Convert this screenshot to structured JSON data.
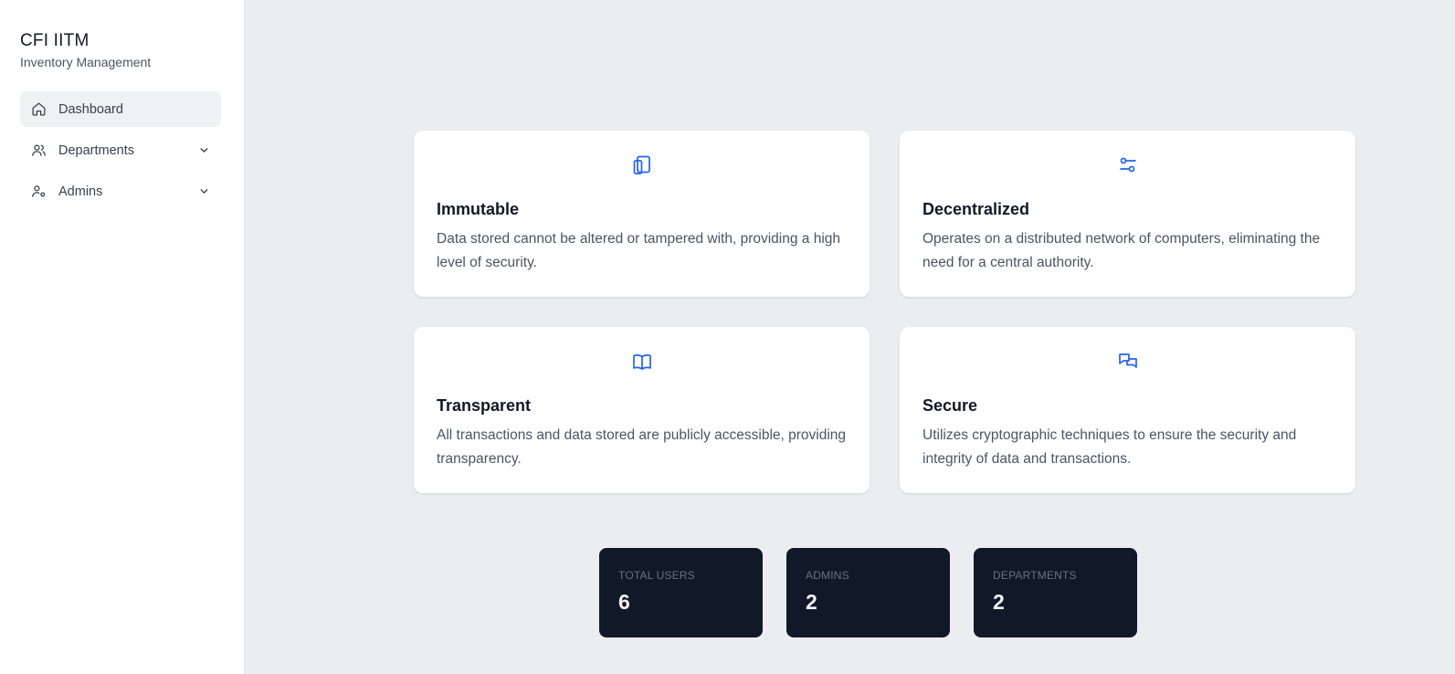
{
  "sidebar": {
    "title": "CFI IITM",
    "subtitle": "Inventory Management",
    "items": [
      {
        "label": "Dashboard",
        "icon": "home-icon",
        "active": true
      },
      {
        "label": "Departments",
        "icon": "users-icon",
        "expandable": true
      },
      {
        "label": "Admins",
        "icon": "user-cog-icon",
        "expandable": true
      }
    ]
  },
  "features": [
    {
      "title": "Immutable",
      "description": "Data stored cannot be altered or tampered with, providing a high level of security.",
      "icon": "tablet-icon"
    },
    {
      "title": "Decentralized",
      "description": "Operates on a distributed network of computers, eliminating the need for a central authority.",
      "icon": "sliders-icon"
    },
    {
      "title": "Transparent",
      "description": "All transactions and data stored are publicly accessible, providing transparency.",
      "icon": "book-open-icon"
    },
    {
      "title": "Secure",
      "description": "Utilizes cryptographic techniques to ensure the security and integrity of data and transactions.",
      "icon": "chat-bubbles-icon"
    }
  ],
  "stats": [
    {
      "label": "TOTAL USERS",
      "value": "6"
    },
    {
      "label": "ADMINS",
      "value": "2"
    },
    {
      "label": "DEPARTMENTS",
      "value": "2"
    }
  ],
  "colors": {
    "accent": "#2563eb",
    "stat_bg": "#111827",
    "page_bg": "#ecedf1"
  }
}
